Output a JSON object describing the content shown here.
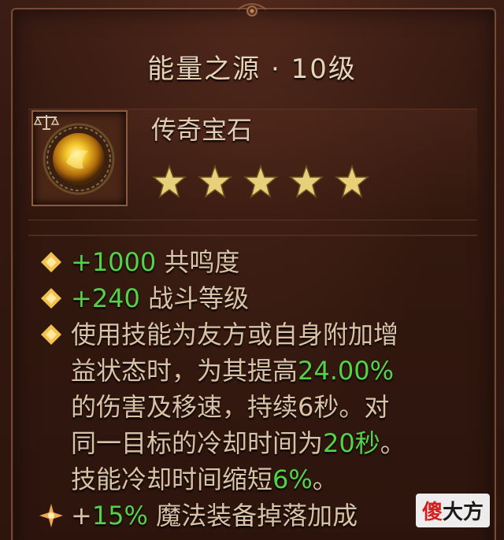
{
  "title": "能量之源 · 10级",
  "item": {
    "type": "传奇宝石",
    "rating_stars": 5,
    "max_stars": 5,
    "icon": "golden-gem-icon",
    "category_icon": "scales-icon"
  },
  "properties": [
    {
      "bullet": "diamond-bullet-icon",
      "value": "+1000",
      "label": "共鸣度"
    },
    {
      "bullet": "diamond-bullet-icon",
      "value": "+240",
      "label": "战斗等级"
    }
  ],
  "effect": {
    "bullet": "diamond-bullet-icon",
    "line1": "使用技能为友方或自身附加增",
    "line2_pre": "益状态时，为其提高",
    "line2_val": "24.00%",
    "line3_pre": "的伤害及移速，持续6秒。对",
    "line4_pre": "同一目标的冷却时间为",
    "line4_val": "20秒",
    "line4_post": "。",
    "line5_pre": "技能冷却时间缩短",
    "line5_val": "6%",
    "line5_post": "。"
  },
  "bonus": {
    "bullet": "sparkle-bullet-icon",
    "prefix": "+",
    "value": "15%",
    "label": "魔法装备掉落加成"
  },
  "watermark": {
    "part1": "傻",
    "part2": "大方"
  },
  "colors": {
    "highlight": "#55d24a",
    "text": "#d9c2a6",
    "bullet": "#f2c14e",
    "star": "#e8cf7a"
  }
}
